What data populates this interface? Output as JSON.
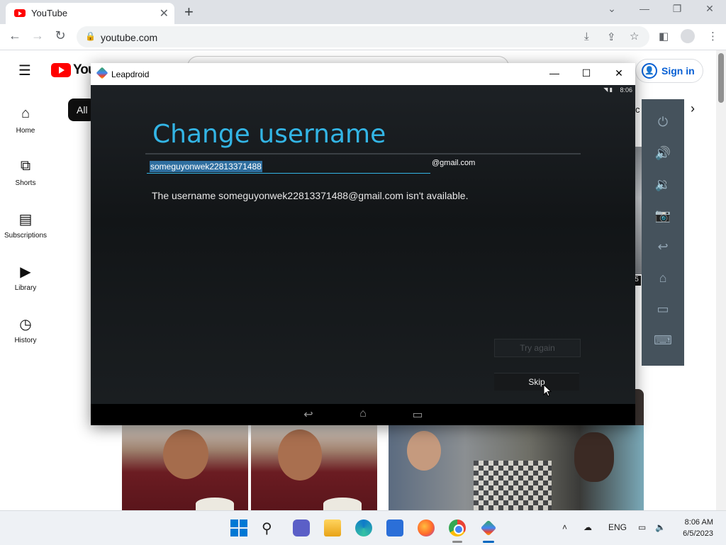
{
  "browser": {
    "tab_title": "YouTube",
    "url": "youtube.com"
  },
  "youtube": {
    "logo_text": "You",
    "sidebar": [
      {
        "label": "Home",
        "icon": "home-icon"
      },
      {
        "label": "Shorts",
        "icon": "shorts-icon"
      },
      {
        "label": "Subscriptions",
        "icon": "subscriptions-icon"
      },
      {
        "label": "Library",
        "icon": "library-icon"
      },
      {
        "label": "History",
        "icon": "history-icon"
      }
    ],
    "chip_all": "All",
    "sign_in": "Sign in",
    "partial_chip_letter": "c",
    "partial_badge": "5"
  },
  "leapdroid": {
    "window_title": "Leapdroid",
    "status_time": "8:06",
    "heading": "Change username",
    "username_value": "someguyonwek22813371488",
    "domain_suffix": "@gmail.com",
    "error_message": "The username someguyonwek22813371488@gmail.com isn't available.",
    "try_again_label": "Try again",
    "skip_label": "Skip",
    "panel_buttons": [
      "power-icon",
      "volume-up-icon",
      "volume-down-icon",
      "camera-icon",
      "back-icon",
      "home-icon",
      "recent-apps-icon",
      "keyboard-icon"
    ]
  },
  "taskbar": {
    "apps": [
      "windows-start-icon",
      "search-icon",
      "teams-icon",
      "file-explorer-icon",
      "edge-icon",
      "store-icon",
      "firefox-icon",
      "chrome-icon",
      "leapdroid-icon"
    ],
    "language": "ENG",
    "time": "8:06 AM",
    "date": "6/5/2023"
  },
  "colors": {
    "android_accent": "#33b5e5",
    "youtube_red": "#ff0000",
    "signin_blue": "#065fd4"
  }
}
